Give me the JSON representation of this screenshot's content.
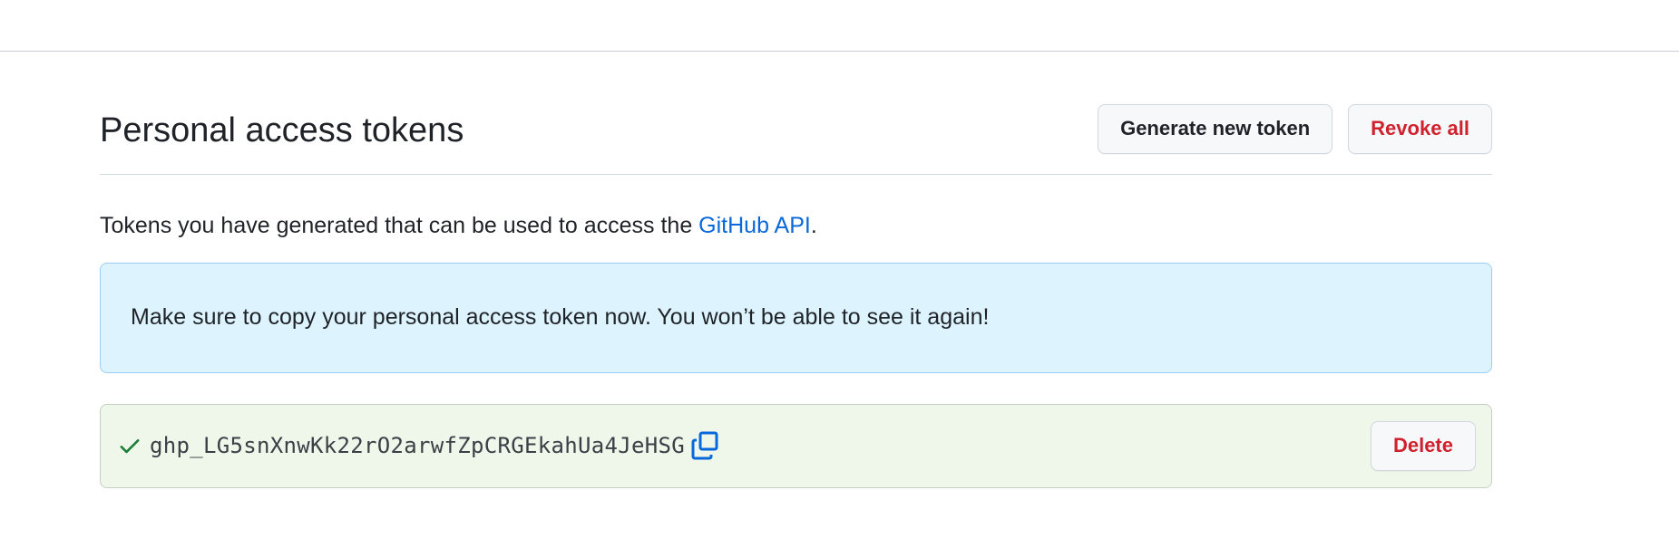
{
  "page": {
    "title": "Personal access tokens",
    "intro_text": "Tokens you have generated that can be used to access the ",
    "intro_link": "GitHub API",
    "intro_suffix": "."
  },
  "header": {
    "generate_label": "Generate new token",
    "revoke_label": "Revoke all"
  },
  "flash": {
    "message": "Make sure to copy your personal access token now. You won’t be able to see it again!"
  },
  "token": {
    "value": "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",
    "delete_label": "Delete",
    "status_icon": "check-icon",
    "copy_icon": "copy-icon"
  },
  "colors": {
    "link": "#0969da",
    "danger": "#cf222e",
    "success": "#1a7f37",
    "flash_bg": "#ddf4ff",
    "token_bg": "#eff6ea"
  }
}
